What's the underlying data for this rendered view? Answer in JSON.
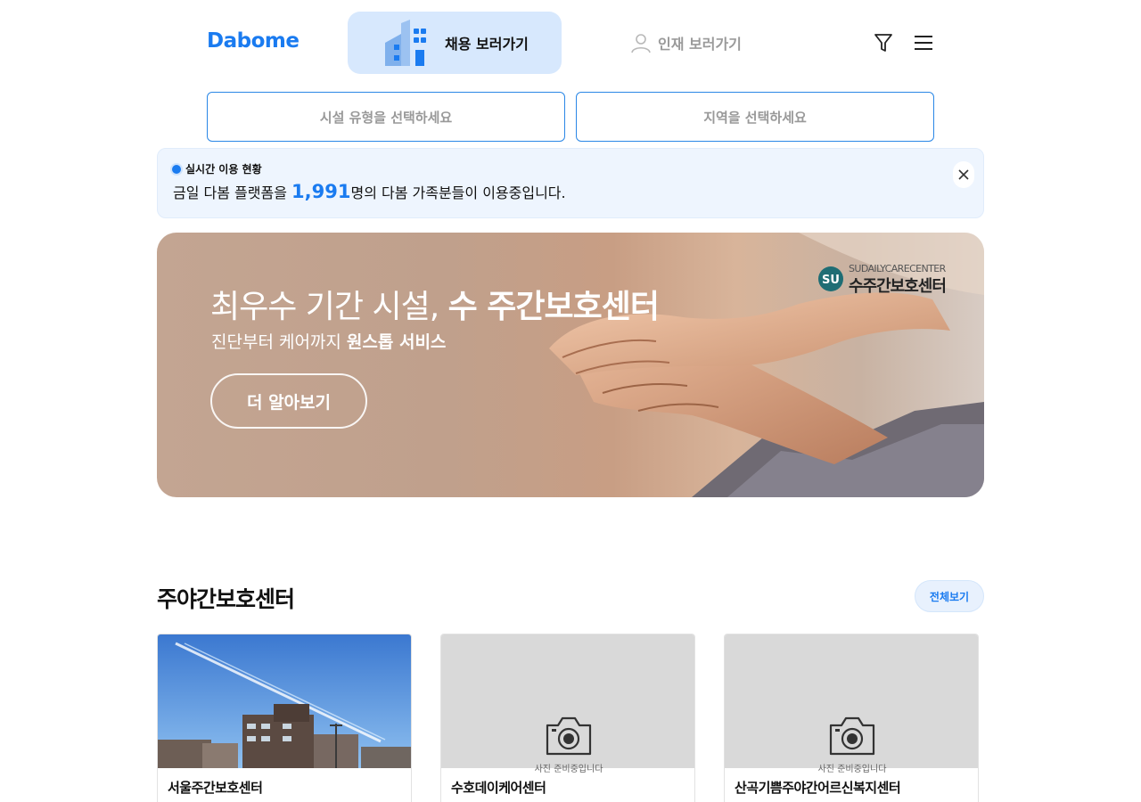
{
  "header": {
    "logo": "Dabome",
    "tab_jobs_label": "채용 보러가기",
    "tab_talent_label": "인재 보러가기",
    "icons": [
      "building-icon",
      "person-icon",
      "filter-icon",
      "menu-icon"
    ]
  },
  "filters": {
    "facility_type_placeholder": "시설 유형을 선택하세요",
    "region_placeholder": "지역을 선택하세요"
  },
  "live_status": {
    "tag": "실시간 이용 현황",
    "message_prefix": "금일 다봄 플랫폼을 ",
    "count": "1,991",
    "message_suffix": "명의 다봄 가족분들이 이용중입니다."
  },
  "banner": {
    "headline_normal": "최우수 기간 시설, ",
    "headline_bold": "수 주간보호센터",
    "sub_normal": "진단부터 케어까지 ",
    "sub_bold": "원스톱 서비스",
    "button": "더 알아보기",
    "brand_en": "SUDAILYCARECENTER",
    "brand_ko": "수주간보호센터"
  },
  "section": {
    "title": "주야간보호센터",
    "view_all": "전체보기"
  },
  "cards": [
    {
      "name": "서울주간보호센터",
      "image": "photo"
    },
    {
      "name": "수호데이케어센터",
      "image": "placeholder",
      "caption": "사진 준비중입니다"
    },
    {
      "name": "산곡기쁨주야간어르신복지센터",
      "image": "placeholder",
      "caption": "사진 준비중입니다"
    }
  ],
  "colors": {
    "accent": "#1a7bf0",
    "tab_active_bg": "#d7e8fd",
    "live_bg": "#eef5fe",
    "select_border": "#2a87e6"
  }
}
